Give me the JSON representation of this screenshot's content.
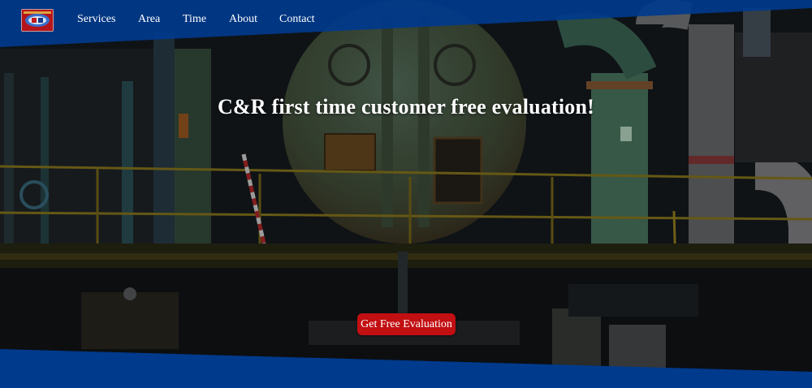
{
  "nav": {
    "logo_label": "C&R",
    "items": [
      {
        "label": "Services"
      },
      {
        "label": "Area"
      },
      {
        "label": "Time"
      },
      {
        "label": "About"
      },
      {
        "label": "Contact"
      }
    ]
  },
  "hero": {
    "headline": "C&R first time customer free evaluation!",
    "cta_label": "Get Free Evaluation"
  },
  "colors": {
    "brand_blue": "#003a8c",
    "cta_red": "#c20f12",
    "text": "#ffffff"
  }
}
